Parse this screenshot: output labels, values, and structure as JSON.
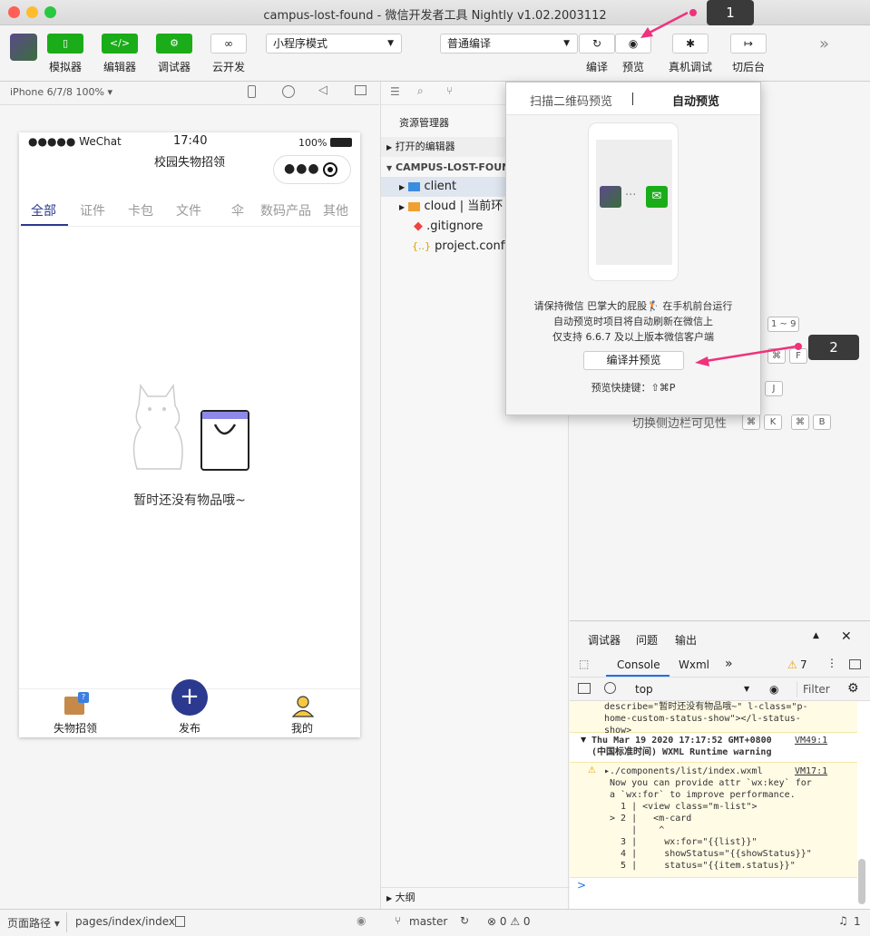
{
  "window": {
    "title": "campus-lost-found - 微信开发者工具 Nightly v1.02.2003112"
  },
  "toolbar": {
    "simulator": "模拟器",
    "editor": "编辑器",
    "debugger": "调试器",
    "cloud": "云开发",
    "mode_select": "小程序模式",
    "compile_select": "普通编译",
    "compile": "编译",
    "preview": "预览",
    "remote_debug": "真机调试",
    "background": "切后台",
    "more": "»"
  },
  "simbar": {
    "device": "iPhone 6/7/8 100% ▾"
  },
  "phone": {
    "status": {
      "carrier": "●●●●● WeChat",
      "time": "17:40",
      "battery": "100%"
    },
    "nav_title": "校园失物招领",
    "tabs": [
      "全部",
      "证件",
      "卡包",
      "文件",
      "伞",
      "数码产品",
      "其他"
    ],
    "empty_text": "暂时还没有物品哦~",
    "tabbar": {
      "lost": "失物招领",
      "publish": "发布",
      "mine": "我的",
      "badge": "?"
    }
  },
  "explorer": {
    "title": "资源管理器",
    "open_editors": "打开的编辑器",
    "project": "CAMPUS-LOST-FOUND",
    "items": [
      "client",
      "cloud | 当前环",
      ".gitignore",
      "project.config"
    ],
    "outline": "大纲"
  },
  "shortcuts": {
    "toggle_sidebar": "切换侧边栏可见性",
    "keys_1": "1 ~ 9",
    "keys_f": "F",
    "keys_j": "J",
    "keys_k": "K",
    "keys_b": "B",
    "cmd": "⌘"
  },
  "popup": {
    "tab_qr": "扫描二维码预览",
    "tab_auto": "自动预览",
    "line1": "请保持微信 巴掌大的屁股🏌 在手机前台运行",
    "line2": "自动预览时项目将自动刷新在微信上",
    "line3": "仅支持 6.6.7 及以上版本微信客户端",
    "button": "编译并预览",
    "shortcut": "预览快捷键：⇧⌘P",
    "dots": "···"
  },
  "callouts": {
    "one": "1",
    "two": "2"
  },
  "devtools": {
    "tabs": [
      "调试器",
      "问题",
      "输出"
    ],
    "subtabs": [
      "Console",
      "Wxml"
    ],
    "warn_count": "7",
    "context": "top",
    "filter": "Filter",
    "log1": "describe=\"暂时还没有物品哦~\" l-class=\"p-\nhome-custom-status-show\"></l-status-\nshow>",
    "warn_head": "Thu Mar 19 2020 17:17:52 GMT+0800\n(中国标准时间) WXML Runtime warning",
    "warn_link": "VM49:1",
    "warn_file": "▸./components/list/index.wxml",
    "warn_file_link": "VM17:1",
    "warn_body": " Now you can provide attr `wx:key` for\n a `wx:for` to improve performance.\n   1 | <view class=\"m-list\">\n > 2 |   <m-card\n     |    ^\n   3 |     wx:for=\"{{list}}\"\n   4 |     showStatus=\"{{showStatus}}\"\n   5 |     status=\"{{item.status}}\"",
    "prompt": ">"
  },
  "statusbar": {
    "path_label": "页面路径 ▾",
    "path": "pages/index/index",
    "branch": "master",
    "errors": "⊗ 0 ⚠ 0",
    "notifications": "1"
  },
  "colors": {
    "green": "#1aad19",
    "accent": "#2b3a8f",
    "pink": "#f0317c"
  }
}
